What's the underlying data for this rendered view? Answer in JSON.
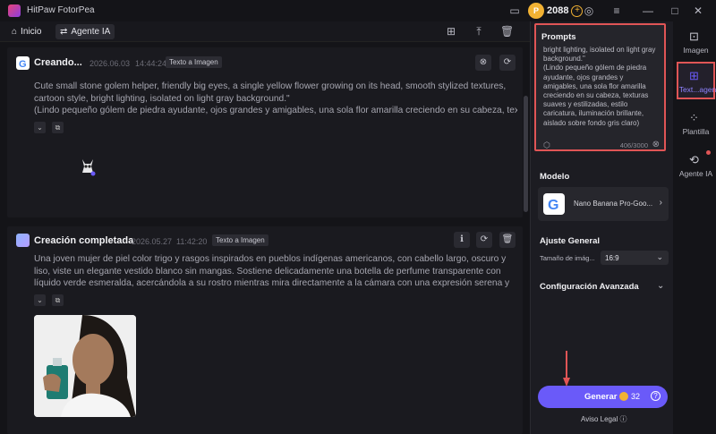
{
  "app": {
    "title": "HitPaw FotorPea",
    "credits": "2088"
  },
  "nav": {
    "home": "Inicio",
    "agent": "Agente IA"
  },
  "cards": [
    {
      "title": "Creando...",
      "date": "2026.06.03",
      "time": "14:44:24",
      "tag": "Texto a Imagen",
      "prompt_en": "Cute small stone golem helper, friendly big eyes, a single yellow flower growing on its head, smooth stylized textures, cartoon style, bright lighting, isolated on light gray background.\"",
      "prompt_es": "(Lindo pequeño gólem de piedra ayudante, ojos grandes y amigables, una sola flor amarilla creciendo en su cabeza, textur..."
    },
    {
      "title": "Creación completada",
      "date": "2026.05.27",
      "time": "11:42:20",
      "tag": "Texto a Imagen",
      "prompt": "Una joven mujer de piel color trigo y rasgos inspirados en pueblos indígenas americanos, con cabello largo, oscuro y liso, viste un elegante vestido blanco sin mangas. Sostiene delicadamente una botella de perfume transparente con líquido verde esmeralda, acercándola a su rostro mientras mira directamente a la cámara con una expresión serena y poderosa. Sus facc..."
    }
  ],
  "panel": {
    "prompts_label": "Prompts",
    "prompt_text": "bright lighting, isolated on light gray background.\"\n(Lindo pequeño gólem de piedra ayudante, ojos grandes y amigables, una sola flor amarilla creciendo en su cabeza, texturas suaves y estilizadas, estilo caricatura, iluminación brillante, aislado sobre fondo gris claro)",
    "counter": "406/3000",
    "model_label": "Modelo",
    "model_name": "Nano Banana Pro-Goo...",
    "ajuste_label": "Ajuste General",
    "size_label": "Tamaño de imág...",
    "size_value": "16:9",
    "advanced_label": "Configuración Avanzada",
    "generate_label": "Generar",
    "generate_cost": "32",
    "legal": "Aviso Legal"
  },
  "sidebar": [
    {
      "label": "Imagen"
    },
    {
      "label": "Text...agen"
    },
    {
      "label": "Plantilla"
    },
    {
      "label": "Agente IA"
    }
  ],
  "colors": {
    "accent": "#6a5af9",
    "highlight": "#e05556",
    "coin": "#f2b233"
  }
}
